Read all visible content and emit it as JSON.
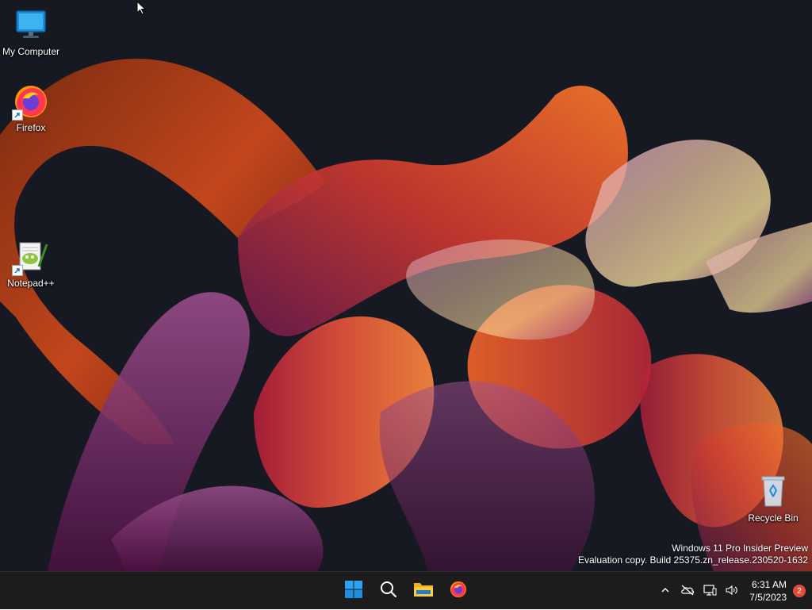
{
  "desktop": {
    "icons": [
      {
        "label": "My Computer",
        "icon": "monitor-icon"
      },
      {
        "label": "Firefox",
        "icon": "firefox-icon"
      },
      {
        "label": "Notepad++",
        "icon": "notepadpp-icon"
      },
      {
        "label": "Recycle Bin",
        "icon": "recycle-bin-icon"
      }
    ],
    "watermark": {
      "line1": "Windows 11 Pro Insider Preview",
      "line2": "Evaluation copy. Build 25375.zn_release.230520-1632"
    }
  },
  "taskbar": {
    "pinned": [
      {
        "name": "Start",
        "icon": "windows-start-icon"
      },
      {
        "name": "Search",
        "icon": "search-icon"
      },
      {
        "name": "File Explorer",
        "icon": "folder-icon"
      },
      {
        "name": "Firefox",
        "icon": "firefox-icon"
      }
    ],
    "tray": {
      "icons": [
        "chevron-up-icon",
        "cloud-offline-icon",
        "network-icon",
        "speaker-icon"
      ],
      "time": "6:31 AM",
      "date": "7/5/2023",
      "notification_count": "2"
    }
  },
  "colors": {
    "taskbar_bg": "#1c1c1c",
    "desktop_bg": "#141620",
    "accent_blue": "#0078d4",
    "badge_red": "#e64a3b"
  }
}
